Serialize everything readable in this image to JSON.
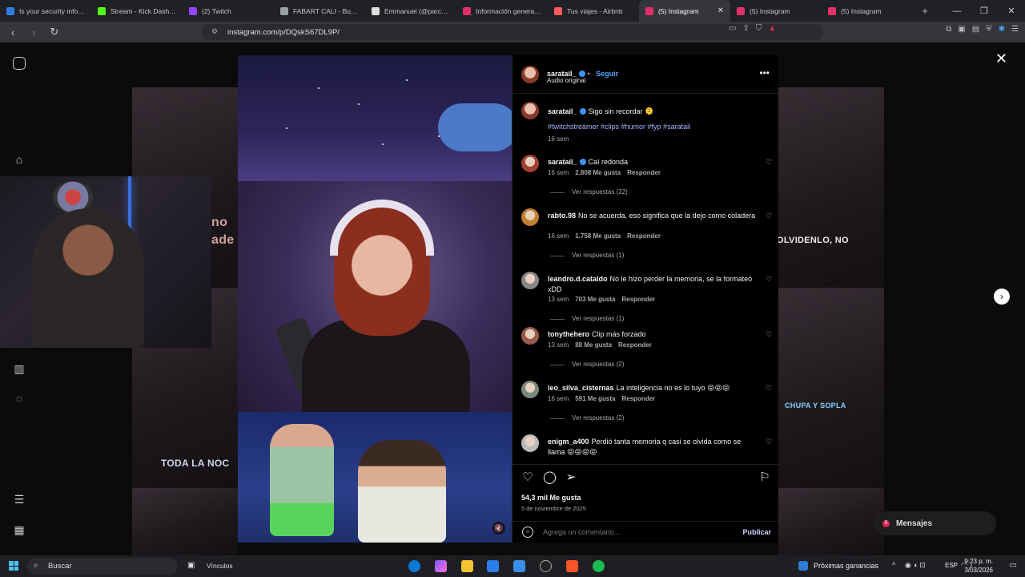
{
  "browser": {
    "tabs": [
      {
        "title": "Is your security info sti",
        "color": "#2f7be0"
      },
      {
        "title": "Stream - Kick Dashboa",
        "color": "#53fc18"
      },
      {
        "title": "(2) Twitch",
        "color": "#9146ff"
      },
      {
        "title": "FABART CALI - Buscar",
        "color": "#9aa0a6"
      },
      {
        "title": "Emmanuel (@parchate",
        "color": "#ddd"
      },
      {
        "title": "Información general de",
        "color": "#e1306c"
      },
      {
        "title": "Tus viajes - Airbnb",
        "color": "#ff5a5f"
      },
      {
        "title": "(5) Instagram",
        "color": "#e1306c",
        "active": true
      },
      {
        "title": "(5) Instagram",
        "color": "#e1306c"
      },
      {
        "title": "(5) Instagram",
        "color": "#e1306c"
      }
    ],
    "url": "instagram.com/p/DQskS67DL9P/"
  },
  "overlay_texts": {
    "left_no": "no",
    "left_ade": "ade",
    "olvidenlo": "OLVIDENLO, NO",
    "chupa": "CHUPA Y SOPLA",
    "toda": "TODA LA NOC"
  },
  "post": {
    "author": "saratail_",
    "follow": "Seguir",
    "audio": "Audio original",
    "caption": "Sigo sin recordar 🫠",
    "hashtags": "#twitchstreamer #clips #humor #fyp #saratail",
    "caption_age": "16 sem",
    "likes": "54,3 mil Me gusta",
    "date": "5 de noviembre de 2025",
    "add_comment_placeholder": "Agrega un comentario...",
    "publish": "Publicar"
  },
  "comments": [
    {
      "user": "saratail_",
      "verified": true,
      "text": "Caí redonda",
      "age": "16 sem",
      "likes": "2.808 Me gusta",
      "reply": "Responder",
      "replies": "Ver respuestas (22)"
    },
    {
      "user": "rabto.98",
      "text": "No se acuerda, eso significa que la dejo como coladera",
      "age": "16 sem",
      "likes": "1.758 Me gusta",
      "reply": "Responder",
      "replies": "Ver respuestas (1)"
    },
    {
      "user": "leandro.d.cataldo",
      "text": "No le hizo perder la memoria, se la formateó xDD",
      "age": "13 sem",
      "likes": "703 Me gusta",
      "reply": "Responder",
      "replies": "Ver respuestas (1)"
    },
    {
      "user": "tonythehero",
      "text": "Clip más forzado",
      "age": "13 sem",
      "likes": "88 Me gusta",
      "reply": "Responder",
      "replies": "Ver respuestas (2)"
    },
    {
      "user": "leo_silva_cisternas",
      "text": "La inteligencia no es lo tuyo 😝😝😝",
      "age": "16 sem",
      "likes": "591 Me gusta",
      "reply": "Responder",
      "replies": "Ver respuestas (2)"
    },
    {
      "user": "enigm_a400",
      "text": "Perdió tanta memoria q casi se olvida como se llama 😝😝😝😝",
      "age": "",
      "likes": "",
      "reply": "",
      "replies": ""
    }
  ],
  "messages": {
    "label": "Mensajes",
    "badge": "5"
  },
  "taskbar": {
    "search": "Buscar",
    "links": "Vínculos",
    "info": "Próximas ganancias",
    "lang": "ESP",
    "time": "9:23 p. m.",
    "date": "3/03/2026"
  }
}
